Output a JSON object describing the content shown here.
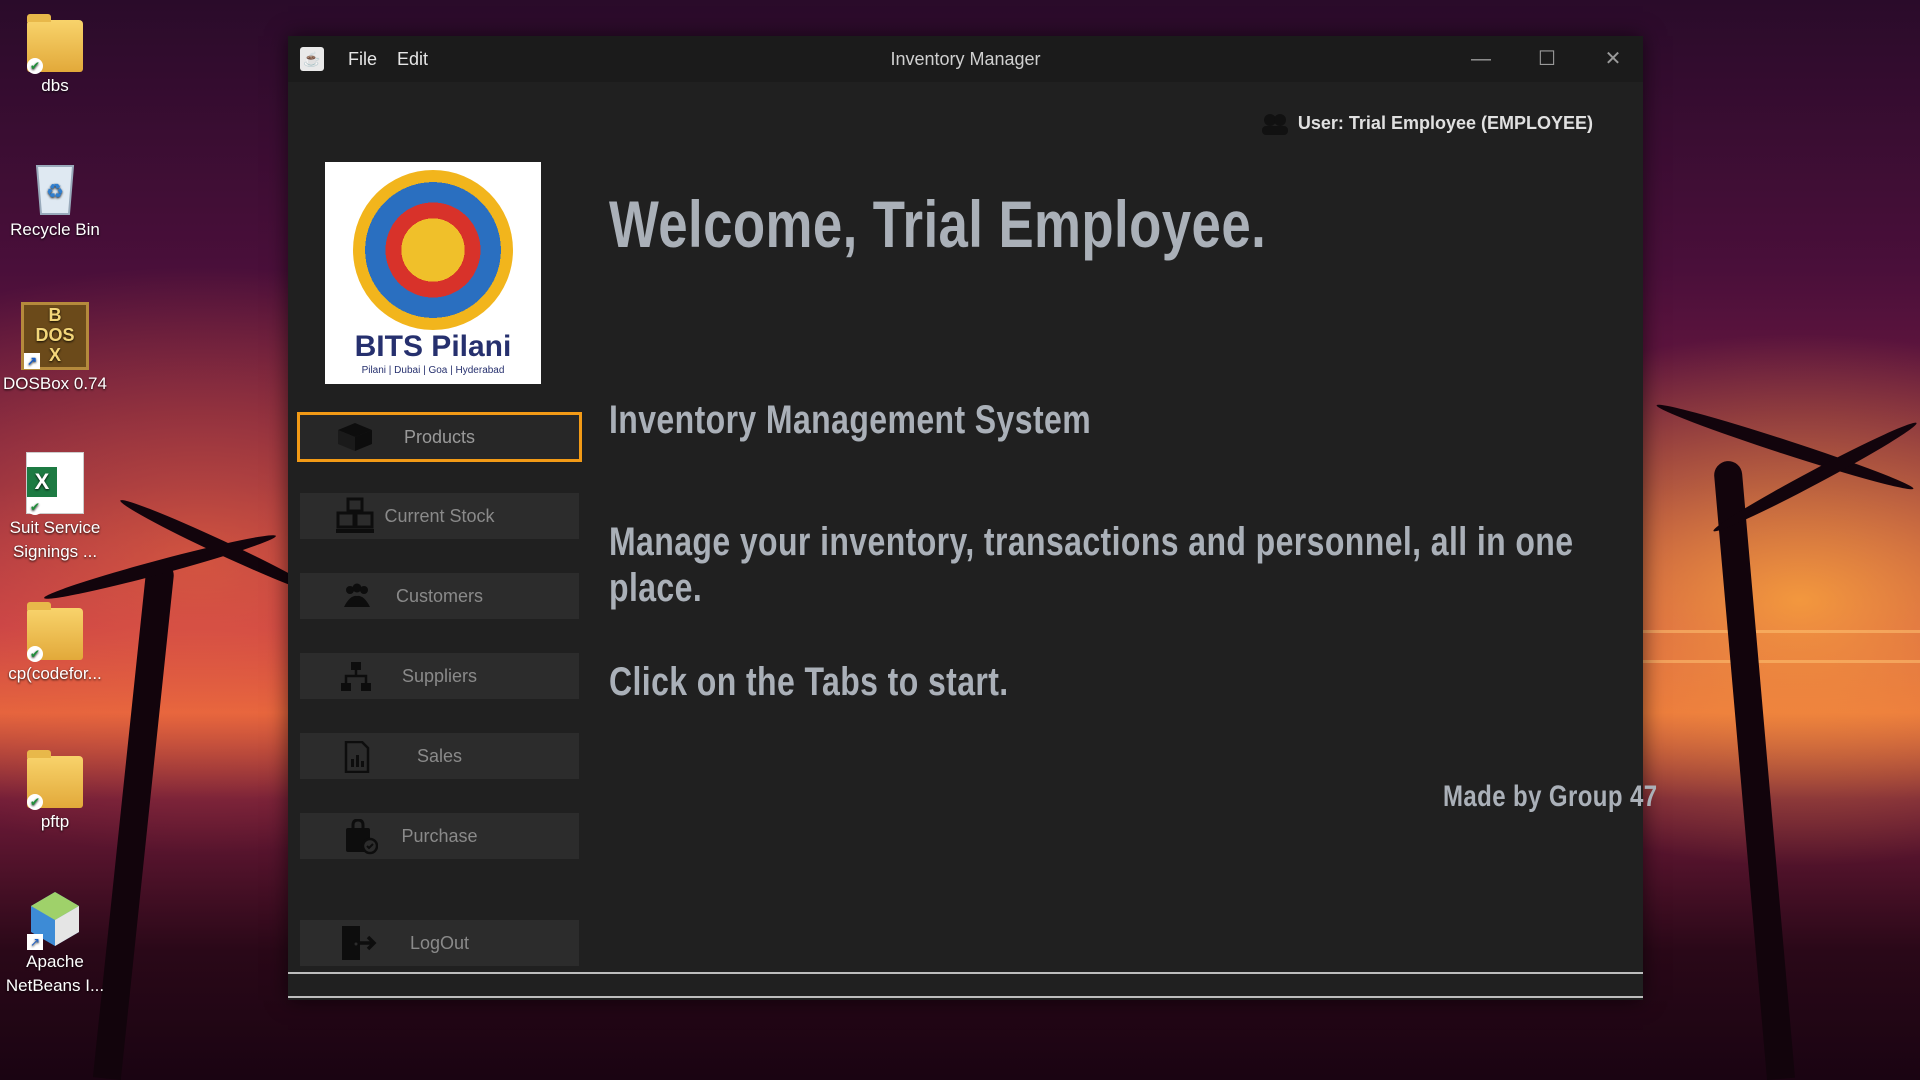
{
  "desktop": {
    "icons": [
      {
        "label": "dbs",
        "icon": "folder-icon"
      },
      {
        "label": "Recycle Bin",
        "icon": "recycle-bin-icon"
      },
      {
        "label": "DOSBox 0.74",
        "icon": "dosbox-icon"
      },
      {
        "label_line1": "Suit Service",
        "label_line2": "Signings ...",
        "icon": "excel-icon"
      },
      {
        "label": "cp(codefor...",
        "icon": "folder-icon"
      },
      {
        "label": "pftp",
        "icon": "folder-icon"
      },
      {
        "label_line1": "Apache",
        "label_line2": "NetBeans I...",
        "icon": "netbeans-icon"
      }
    ]
  },
  "window": {
    "title": "Inventory Manager",
    "menu": {
      "file": "File",
      "edit": "Edit"
    },
    "controls": {
      "minimize": "—",
      "maximize": "☐",
      "close": "✕"
    }
  },
  "user": {
    "label": "User: Trial Employee (EMPLOYEE)"
  },
  "logo": {
    "text": "BITS Pilani",
    "subtext": "Pilani | Dubai | Goa | Hyderabad"
  },
  "sidebar": {
    "items": [
      {
        "label": "Products",
        "icon": "box-icon",
        "active": true
      },
      {
        "label": "Current Stock",
        "icon": "boxes-icon"
      },
      {
        "label": "Customers",
        "icon": "people-icon"
      },
      {
        "label": "Suppliers",
        "icon": "network-icon"
      },
      {
        "label": "Sales",
        "icon": "report-icon"
      },
      {
        "label": "Purchase",
        "icon": "shopping-bag-icon"
      }
    ],
    "logout": {
      "label": "LogOut",
      "icon": "logout-icon"
    }
  },
  "main": {
    "welcome": "Welcome,  Trial Employee.",
    "system_name": "Inventory Management System",
    "tagline_line1": "Manage your inventory, transactions and personnel, all in one",
    "tagline_line2": "place.",
    "instruction": "Click on the Tabs to start.",
    "credits": "Made by Group 47"
  },
  "colors": {
    "accent": "#f29a16",
    "text_heading": "#aab0b8",
    "window_bg": "#202020"
  }
}
